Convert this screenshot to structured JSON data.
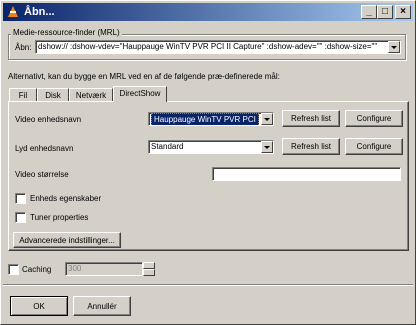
{
  "window": {
    "title": "Åbn...",
    "minimize_glyph": "_",
    "maximize_glyph": "□",
    "close_glyph": "×"
  },
  "mrl_group": {
    "label": "Medie-ressource-finder (MRL)",
    "open_label": "Åbn:",
    "open_value": "dshow:// :dshow-vdev=\"Hauppauge WinTV PVR PCI II Capture\" :dshow-adev=\"\" :dshow-size=\"\""
  },
  "alternative_text": "Alternativt, kan du bygge en MRL ved en af de følgende præ-definerede mål:",
  "tabs": [
    {
      "label": "Fil"
    },
    {
      "label": "Disk"
    },
    {
      "label": "Netværk"
    },
    {
      "label": "DirectShow"
    }
  ],
  "directshow": {
    "video_device_label": "Video enhedsnavn",
    "video_device_value": "Hauppauge WinTV PVR PCI",
    "audio_device_label": "Lyd enhedsnavn",
    "audio_device_value": "Standard",
    "refresh_label": "Refresh list",
    "configure_label": "Configure",
    "video_size_label": "Video størrelse",
    "video_size_value": "",
    "device_props_label": "Enheds egenskaber",
    "device_props_checked": false,
    "tuner_props_label": "Tuner properties",
    "tuner_props_checked": false,
    "advanced_label": "Advancerede indstillinger..."
  },
  "caching": {
    "label": "Caching",
    "checked": false,
    "value": "300"
  },
  "footer": {
    "ok_label": "OK",
    "cancel_label": "Annullér"
  }
}
